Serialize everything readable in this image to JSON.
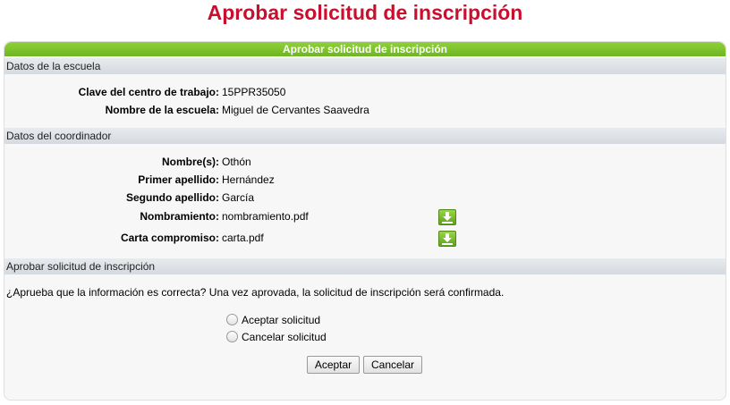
{
  "page": {
    "title": "Aprobar solicitud de inscripción"
  },
  "panel": {
    "header": "Aprobar solicitud de inscripción"
  },
  "school": {
    "section": "Datos de la escuela",
    "fields": [
      {
        "label": "Clave del centro de trabajo:",
        "value": "15PPR35050"
      },
      {
        "label": "Nombre de la escuela:",
        "value": "Miguel de Cervantes Saavedra"
      }
    ]
  },
  "coordinator": {
    "section": "Datos del coordinador",
    "fields": [
      {
        "label": "Nombre(s):",
        "value": "Othón"
      },
      {
        "label": "Primer apellido:",
        "value": "Hernández"
      },
      {
        "label": "Segundo apellido:",
        "value": "García"
      },
      {
        "label": "Nombramiento:",
        "value": "nombramiento.pdf",
        "icon": "download-icon"
      },
      {
        "label": "Carta compromiso:",
        "value": "carta.pdf",
        "icon": "download-icon"
      }
    ]
  },
  "approval": {
    "section": "Aprobar solicitud de inscripción",
    "question": "¿Aprueba que la información es correcta? Una vez aprovada, la solicitud de inscripción será confirmada.",
    "options": [
      {
        "label": "Aceptar solicitud",
        "checked": false
      },
      {
        "label": "Cancelar solicitud",
        "checked": false
      }
    ],
    "accept_button": "Aceptar",
    "cancel_button": "Cancelar"
  },
  "colors": {
    "title": "#c8102e",
    "header": "#7cc22c"
  }
}
